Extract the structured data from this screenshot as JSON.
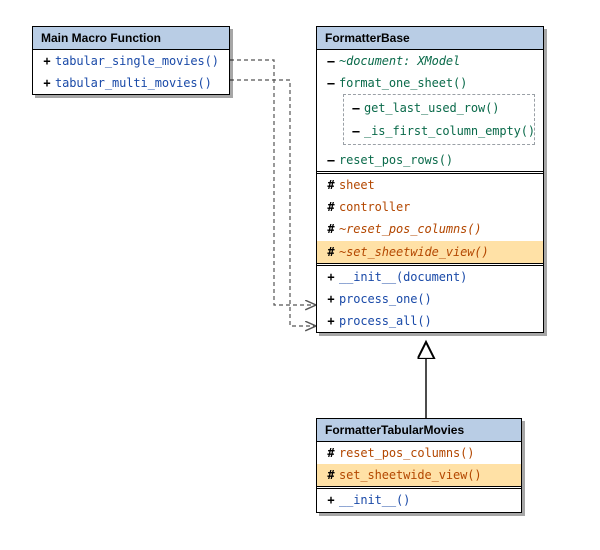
{
  "chart_data": {
    "type": "diagram",
    "title": "UML Class Diagram",
    "classes": [
      {
        "id": "main_macro",
        "name": "Main Macro Function",
        "members": [
          {
            "vis": "public",
            "label": "tabular_single_movies()",
            "virtual": false
          },
          {
            "vis": "public",
            "label": "tabular_multi_movies()",
            "virtual": false
          }
        ]
      },
      {
        "id": "formatter_base",
        "name": "FormatterBase",
        "members": [
          {
            "vis": "private",
            "label": "~document: XModel",
            "virtual": true
          },
          {
            "vis": "private",
            "label": "format_one_sheet()",
            "virtual": false,
            "nested": [
              {
                "vis": "private",
                "label": "get_last_used_row()",
                "virtual": false
              },
              {
                "vis": "private",
                "label": "_is_first_column_empty()",
                "virtual": false
              }
            ]
          },
          {
            "vis": "private",
            "label": "reset_pos_rows()",
            "virtual": false
          },
          {
            "separator": "double"
          },
          {
            "vis": "protected",
            "label": "sheet",
            "virtual": false
          },
          {
            "vis": "protected",
            "label": "controller",
            "virtual": false
          },
          {
            "vis": "protected",
            "label": "~reset_pos_columns()",
            "virtual": true
          },
          {
            "vis": "protected",
            "label": "~set_sheetwide_view()",
            "virtual": true,
            "highlight": true
          },
          {
            "separator": "double"
          },
          {
            "vis": "public",
            "label": "__init__(document)",
            "virtual": false
          },
          {
            "vis": "public",
            "label": "process_one()",
            "virtual": false
          },
          {
            "vis": "public",
            "label": "process_all()",
            "virtual": false
          }
        ]
      },
      {
        "id": "formatter_tabular_movies",
        "name": "FormatterTabularMovies",
        "members": [
          {
            "vis": "protected",
            "label": "reset_pos_columns()",
            "virtual": false
          },
          {
            "vis": "protected",
            "label": "set_sheetwide_view()",
            "virtual": false,
            "highlight": true
          },
          {
            "separator": "double"
          },
          {
            "vis": "public",
            "label": "__init__()",
            "virtual": false
          }
        ]
      }
    ],
    "relations": [
      {
        "from": "main_macro.tabular_single_movies",
        "to": "formatter_base.process_one",
        "style": "dependency"
      },
      {
        "from": "main_macro.tabular_multi_movies",
        "to": "formatter_base.process_all",
        "style": "dependency"
      },
      {
        "from": "formatter_tabular_movies",
        "to": "formatter_base",
        "style": "generalization"
      }
    ]
  },
  "vis_symbols": {
    "public": "+",
    "private": "–",
    "protected": "#"
  },
  "boxes": {
    "main": {
      "title": "Main Macro Function",
      "rows": {
        "r0": "tabular_single_movies()",
        "r1": "tabular_multi_movies()"
      }
    },
    "base": {
      "title": "FormatterBase",
      "rows": {
        "r0": "~document: XModel",
        "r1": "format_one_sheet()",
        "n0": "get_last_used_row()",
        "n1": "_is_first_column_empty()",
        "r2": "reset_pos_rows()",
        "r3": "sheet",
        "r4": "controller",
        "r5": "~reset_pos_columns()",
        "r6": "~set_sheetwide_view()",
        "r7": "__init__(document)",
        "r8": "process_one()",
        "r9": "process_all()"
      }
    },
    "child": {
      "title": "FormatterTabularMovies",
      "rows": {
        "r0": "reset_pos_columns()",
        "r1": "set_sheetwide_view()",
        "r2": "__init__()"
      }
    }
  }
}
